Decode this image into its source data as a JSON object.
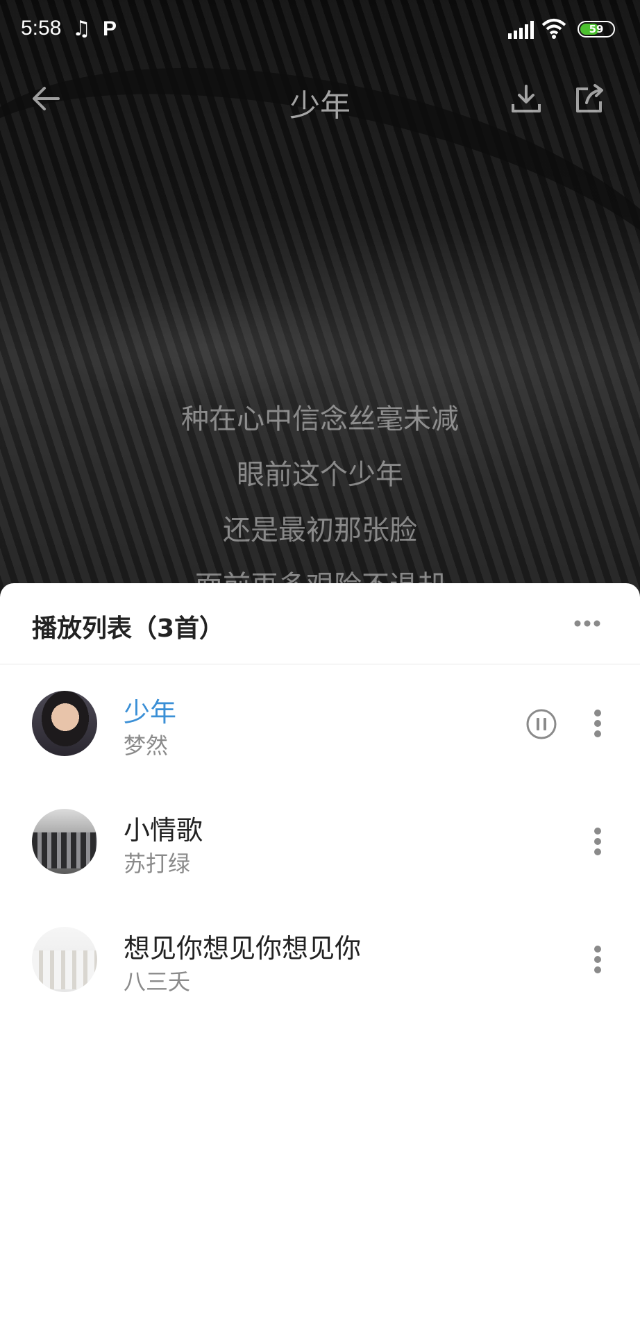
{
  "status_bar": {
    "time": "5:58",
    "icons": [
      "music-note-icon",
      "p-icon",
      "signal-icon",
      "wifi-icon",
      "battery-icon"
    ],
    "p_label": "P",
    "battery_level": "59",
    "battery_fraction": 0.59,
    "battery_color": "#4cc12f"
  },
  "header": {
    "title": "少年",
    "icons": [
      "back-arrow-icon",
      "download-icon",
      "share-icon"
    ]
  },
  "lyrics": [
    "种在心中信念丝毫未减",
    "眼前这个少年",
    "还是最初那张脸",
    "面前再多艰险不退却"
  ],
  "playlist": {
    "title": "播放列表（3首）",
    "more_icon": "more-horizontal-icon",
    "tracks": [
      {
        "name": "少年",
        "artist": "梦然",
        "playing": true
      },
      {
        "name": "小情歌",
        "artist": "苏打绿",
        "playing": false
      },
      {
        "name": "想见你想见你想见你",
        "artist": "八三夭",
        "playing": false
      }
    ]
  },
  "colors": {
    "accent": "#3a8fd6",
    "text_primary": "#222222",
    "text_secondary": "#8a8a8a"
  }
}
